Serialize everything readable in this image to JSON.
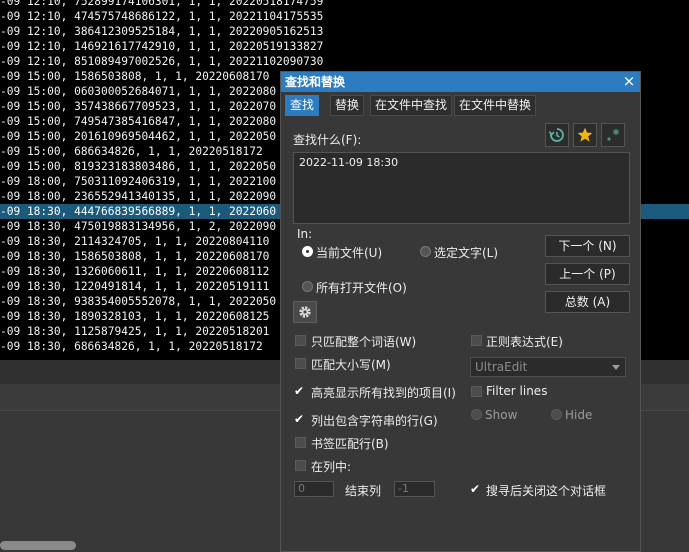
{
  "editor": {
    "lines": [
      {
        "text": "-09 12:10, 752899174106301, 1, 1, 20220518174759",
        "highlighted": false
      },
      {
        "text": "-09 12:10, 474575748686122, 1, 1, 20221104175535",
        "highlighted": false
      },
      {
        "text": "-09 12:10, 386412309525184, 1, 1, 20220905162513",
        "highlighted": false
      },
      {
        "text": "-09 12:10, 146921617742910, 1, 1, 20220519133827",
        "highlighted": false
      },
      {
        "text": "-09 12:10, 851089497002526, 1, 1, 20221102090730",
        "highlighted": false
      },
      {
        "text": "-09 15:00, 1586503808, 1, 1, 20220608170",
        "highlighted": false
      },
      {
        "text": "-09 15:00, 060300052684071, 1, 1, 2022080",
        "highlighted": false
      },
      {
        "text": "-09 15:00, 357438667709523, 1, 1, 2022070",
        "highlighted": false
      },
      {
        "text": "-09 15:00, 749547385416847, 1, 1, 2022080",
        "highlighted": false
      },
      {
        "text": "-09 15:00, 201610969504462, 1, 1, 2022050",
        "highlighted": false
      },
      {
        "text": "-09 15:00, 686634826, 1, 1, 20220518172",
        "highlighted": false
      },
      {
        "text": "-09 15:00, 819323183803486, 1, 1, 2022050",
        "highlighted": false
      },
      {
        "text": "-09 18:00, 750311092406319, 1, 1, 2022100",
        "highlighted": false
      },
      {
        "text": "-09 18:00, 236552941340135, 1, 1, 2022090",
        "highlighted": false
      },
      {
        "text": "-09 18:30, 444766839566889, 1, 1, 2022060",
        "highlighted": true
      },
      {
        "text": "-09 18:30, 475019883134956, 1, 2, 2022090",
        "highlighted": false
      },
      {
        "text": "-09 18:30, 2114324705, 1, 1, 20220804110",
        "highlighted": false
      },
      {
        "text": "-09 18:30, 1586503808, 1, 1, 20220608170",
        "highlighted": false
      },
      {
        "text": "-09 18:30, 1326060611, 1, 1, 20220608112",
        "highlighted": false
      },
      {
        "text": "-09 18:30, 1220491814, 1, 1, 20220519111",
        "highlighted": false
      },
      {
        "text": "-09 18:30, 938354005552078, 1, 1, 2022050",
        "highlighted": false
      },
      {
        "text": "-09 18:30, 1890328103, 1, 1, 20220608125",
        "highlighted": false
      },
      {
        "text": "-09 18:30, 1125879425, 1, 1, 20220518201",
        "highlighted": false
      },
      {
        "text": "-09 18:30, 686634826, 1, 1, 20220518172",
        "highlighted": false
      }
    ]
  },
  "dialog": {
    "title": "查找和替换",
    "close": "×",
    "tabs": [
      {
        "label": "查找",
        "active": true
      },
      {
        "label": "替换",
        "active": false
      },
      {
        "label": "在文件中查找",
        "active": false
      },
      {
        "label": "在文件中替换",
        "active": false
      }
    ],
    "find_label": "查找什么(F):",
    "find_value": "2022-11-09 18:30",
    "in_label": "In:",
    "scope": {
      "current_file": "当前文件(U)",
      "selected_text": "选定文字(L)",
      "all_open_files": "所有打开文件(O)",
      "selected": "current_file"
    },
    "buttons": {
      "find_next": "下一个 (N)",
      "find_prev": "上一个 (P)",
      "count": "总数 (A)"
    },
    "options": {
      "whole_word": {
        "label": "只匹配整个词语(W)",
        "checked": false
      },
      "match_case": {
        "label": "匹配大小写(M)",
        "checked": false
      },
      "highlight_all": {
        "label": "高亮显示所有找到的项目(I)",
        "checked": true
      },
      "list_lines": {
        "label": "列出包含字符串的行(G)",
        "checked": true
      },
      "bookmark": {
        "label": "书签匹配行(B)",
        "checked": false
      },
      "in_column": {
        "label": "在列中:",
        "checked": false
      },
      "regex": {
        "label": "正则表达式(E)",
        "checked": false
      },
      "filter_lines": {
        "label": "Filter lines",
        "checked": false
      },
      "close_after": {
        "label": "搜寻后关闭这个对话框",
        "checked": true
      }
    },
    "regex_engine": "UltraEdit",
    "filter_show": "Show",
    "filter_hide": "Hide",
    "column": {
      "start_value": "0",
      "end_label": "结束列",
      "end_value": "-1"
    },
    "icons": [
      "history-icon",
      "star-icon",
      "regex-star-icon",
      "gear-icon"
    ],
    "colors": {
      "accent": "#2d7cc0",
      "highlight": "#1b5a7a",
      "star": "#f0b419",
      "history": "#5fb3a2"
    }
  }
}
